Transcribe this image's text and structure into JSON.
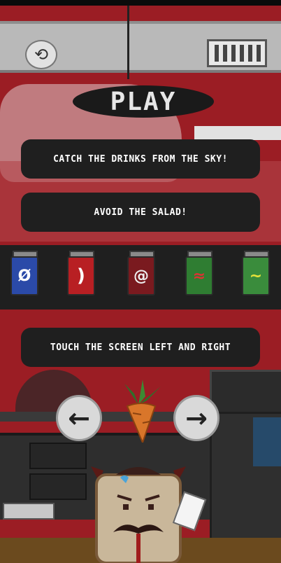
{
  "play_label": "PLAY",
  "instructions": {
    "line1": "CATCH THE DRINKS FROM THE SKY!",
    "line2": "AVOID THE SALAD!",
    "line3": "TOUCH THE SCREEN LEFT AND RIGHT"
  },
  "top_bar": {
    "restart_icon": "restart-icon",
    "pause_icon": "bars-icon"
  },
  "cans": [
    {
      "name": "blue-can",
      "color": "#2b4aa8",
      "mark": "Ø"
    },
    {
      "name": "red-can",
      "color": "#b81f23",
      "mark": ")"
    },
    {
      "name": "darkred-can",
      "color": "#7a1a1f",
      "mark": "@"
    },
    {
      "name": "green-can",
      "color": "#2f7d32",
      "mark": "≈"
    },
    {
      "name": "salad-can",
      "color": "#3a8c3c",
      "mark": "~"
    }
  ],
  "arrows": {
    "left": "←",
    "right": "→"
  },
  "colors": {
    "pill_bg": "#1f1f1f",
    "bg_red": "#9b1d24",
    "wall_gray": "#b8b8b8"
  }
}
